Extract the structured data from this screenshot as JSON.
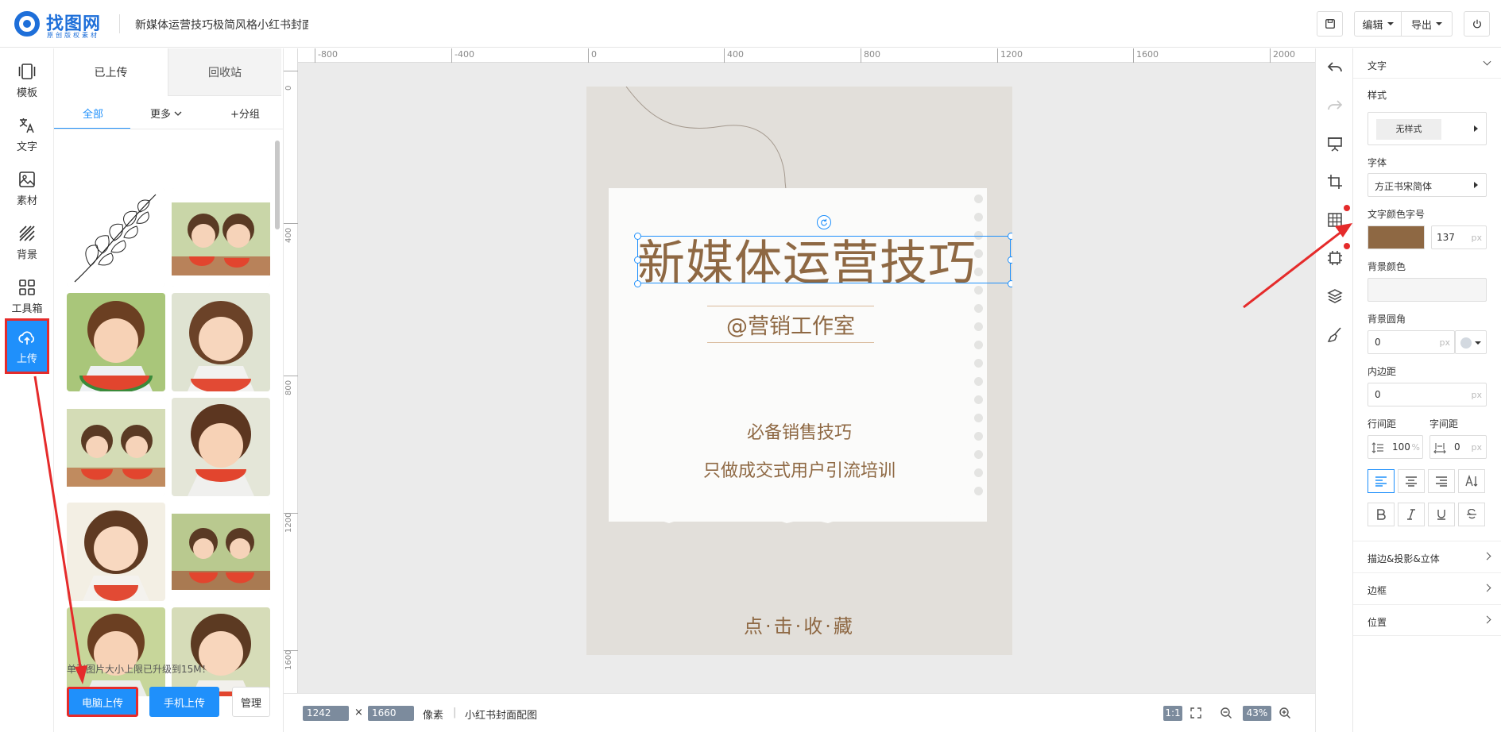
{
  "header": {
    "logo_text": "找图网",
    "logo_sub": "原创版权素材",
    "doc_title": "新媒体运营技巧极简风格小红书封面配图",
    "edit_label": "编辑",
    "export_label": "导出"
  },
  "leftnav": {
    "items": [
      {
        "label": "模板",
        "icon": "template-icon"
      },
      {
        "label": "文字",
        "icon": "text-translate-icon"
      },
      {
        "label": "素材",
        "icon": "image-icon"
      },
      {
        "label": "背景",
        "icon": "background-stripes-icon"
      },
      {
        "label": "工具箱",
        "icon": "toolbox-grid-icon"
      },
      {
        "label": "上传",
        "icon": "cloud-upload-icon"
      }
    ]
  },
  "upload_panel": {
    "tab_uploaded": "已上传",
    "tab_trash": "回收站",
    "filter_all": "全部",
    "filter_more": "更多",
    "filter_group": "+分组",
    "notice": "单张图片大小上限已升级到15M！",
    "btn_pc": "电脑上传",
    "btn_phone": "手机上传",
    "btn_manage": "管理"
  },
  "ruler": {
    "h_labels": [
      "-800",
      "-400",
      "0",
      "400",
      "800",
      "1200",
      "1600",
      "2000"
    ],
    "v_labels": [
      "0",
      "400",
      "800",
      "1200",
      "1600"
    ]
  },
  "canvas": {
    "title": "新媒体运营技巧",
    "studio": "@营销工作室",
    "tip_line1": "必备销售技巧",
    "tip_line2": "只做成交式用户引流培训",
    "collect": "点·击·收·藏",
    "text_color": "#8e6843",
    "page_bg": "#e2dfda"
  },
  "status": {
    "width": "1242",
    "times": "×",
    "height": "1660",
    "unit": "像素",
    "sep": "|",
    "preset": "小红书封面配图",
    "ratio": "1:1",
    "zoom": "43%"
  },
  "props": {
    "section_text": "文字",
    "style_label": "样式",
    "style_value": "无样式",
    "font_label": "字体",
    "font_value": "方正书宋简体",
    "color_size_label": "文字颜色字号",
    "color_value": "#8e6843",
    "size_value": "137",
    "unit_px": "px",
    "bg_color_label": "背景颜色",
    "bg_radius_label": "背景圆角",
    "bg_radius_value": "0",
    "padding_label": "内边距",
    "padding_value": "0",
    "line_height_label": "行间距",
    "line_height_value": "100",
    "line_height_unit": "%",
    "letter_spacing_label": "字间距",
    "letter_spacing_value": "0",
    "section_stroke": "描边&投影&立体",
    "section_border": "边框",
    "section_position": "位置"
  }
}
